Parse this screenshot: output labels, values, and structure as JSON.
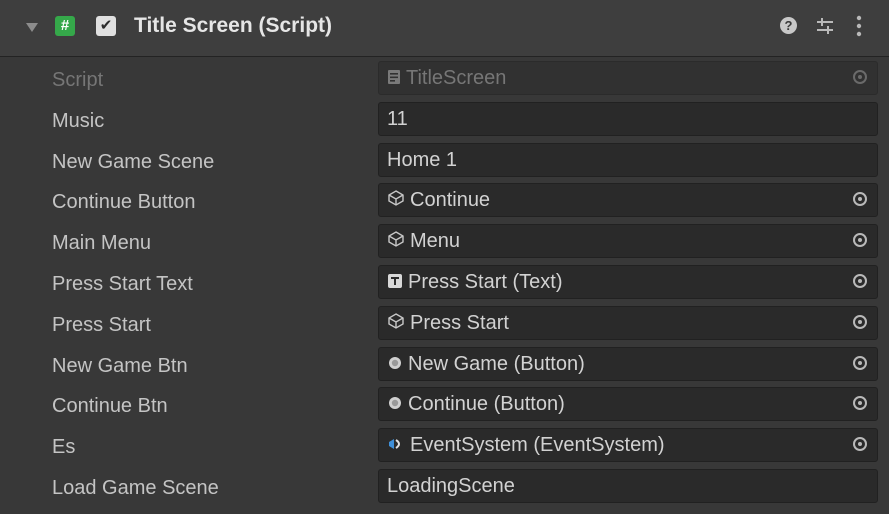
{
  "component": {
    "title": "Title Screen (Script)",
    "script_icon_glyph": "#",
    "enabled_glyph": "✔",
    "help_glyph": "?"
  },
  "fields": [
    {
      "label": "Script",
      "value": "TitleScreen",
      "icon": "script-asset-icon",
      "picker": true,
      "disabled": true
    },
    {
      "label": "Music",
      "value": "11",
      "icon": "",
      "picker": false,
      "disabled": false
    },
    {
      "label": "New Game Scene",
      "value": "Home 1",
      "icon": "",
      "picker": false,
      "disabled": false
    },
    {
      "label": "Continue Button",
      "value": "Continue",
      "icon": "gameobject-icon",
      "picker": true,
      "disabled": false
    },
    {
      "label": "Main Menu",
      "value": "Menu",
      "icon": "gameobject-icon",
      "picker": true,
      "disabled": false
    },
    {
      "label": "Press Start Text",
      "value": "Press Start (Text)",
      "icon": "text-component-icon",
      "picker": true,
      "disabled": false
    },
    {
      "label": "Press Start",
      "value": "Press Start",
      "icon": "gameobject-icon",
      "picker": true,
      "disabled": false
    },
    {
      "label": "New Game Btn",
      "value": "New Game (Button)",
      "icon": "button-component-icon",
      "picker": true,
      "disabled": false
    },
    {
      "label": "Continue Btn",
      "value": "Continue (Button)",
      "icon": "button-component-icon",
      "picker": true,
      "disabled": false
    },
    {
      "label": "Es",
      "value": "EventSystem (EventSystem)",
      "icon": "eventsystem-icon",
      "picker": true,
      "disabled": false
    },
    {
      "label": "Load Game Scene",
      "value": "LoadingScene",
      "icon": "",
      "picker": false,
      "disabled": false
    }
  ],
  "colors": {
    "background": "#383838",
    "header": "#3e3e3e",
    "field": "#2a2a2a",
    "script_icon": "#35a84a",
    "eventsystem_icon": "#3f8fd8"
  }
}
